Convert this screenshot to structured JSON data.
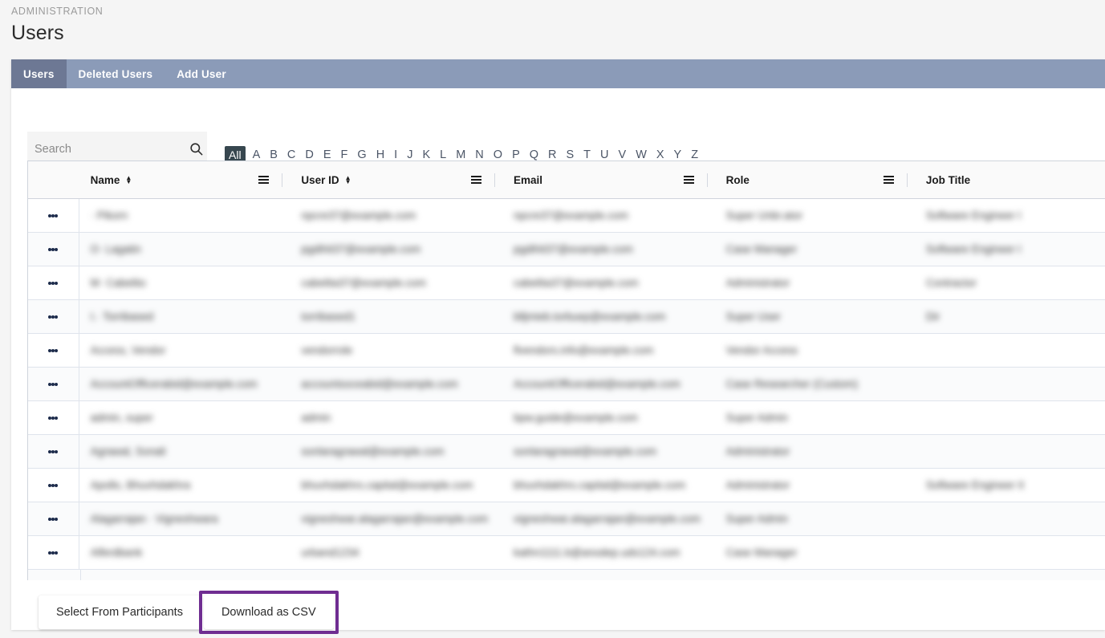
{
  "breadcrumb": "ADMINISTRATION",
  "page_title": "Users",
  "tabs": [
    {
      "label": "Users",
      "active": true
    },
    {
      "label": "Deleted Users",
      "active": false
    },
    {
      "label": "Add User",
      "active": false
    }
  ],
  "search": {
    "value": "",
    "placeholder": "Search",
    "icon": "search-icon"
  },
  "alpha_filter": {
    "selected": "All",
    "items": [
      "All",
      "A",
      "B",
      "C",
      "D",
      "E",
      "F",
      "G",
      "H",
      "I",
      "J",
      "K",
      "L",
      "M",
      "N",
      "O",
      "P",
      "Q",
      "R",
      "S",
      "T",
      "U",
      "V",
      "W",
      "X",
      "Y",
      "Z"
    ]
  },
  "table": {
    "columns": [
      {
        "key": "menu",
        "label": "",
        "sortable": false,
        "has_menu": false
      },
      {
        "key": "name",
        "label": "Name",
        "sortable": true,
        "has_menu": true
      },
      {
        "key": "uid",
        "label": "User ID",
        "sortable": true,
        "has_menu": true
      },
      {
        "key": "email",
        "label": "Email",
        "sortable": false,
        "has_menu": true
      },
      {
        "key": "role",
        "label": "Role",
        "sortable": false,
        "has_menu": true
      },
      {
        "key": "job",
        "label": "Job Title",
        "sortable": false,
        "has_menu": false
      }
    ],
    "sort_glyph_up": "▲",
    "sort_glyph_down": "▼",
    "redacted": true,
    "rows": [
      {
        "name": "· Pikorn",
        "uid": "npcre37@example.com",
        "email": "npcre37@example.com",
        "role": "Super Unbr.ator",
        "job": "Software Engineer I"
      },
      {
        "name": "O· Lagatin",
        "uid": "pgdihit37@example.com",
        "email": "pgdihit37@example.com",
        "role": "Case Manager",
        "job": "Software Engineer I"
      },
      {
        "name": "M· Cabelito",
        "uid": "cabelita37@example.com",
        "email": "cabelita37@example.com",
        "role": "Administrator",
        "job": "Contractor"
      },
      {
        "name": "I.· Torribased",
        "uid": "torribased1",
        "email": "blljmieb.torbuep@example.com",
        "role": "Super User",
        "job": "Dir"
      },
      {
        "name": "Access, Vendor",
        "uid": "vendorrole",
        "email": "flvendors.info@example.com",
        "role": "Vendor Access",
        "job": ""
      },
      {
        "name": "AccountOfficerabid@example.com",
        "uid": "accountsoceabid@example.com",
        "email": "AccountOfficerabid@example.com",
        "role": "Case Researcher (Custom)",
        "job": ""
      },
      {
        "name": "admin, super",
        "uid": "admin",
        "email": "bpw.guide@example.com",
        "role": "Super Admin",
        "job": ""
      },
      {
        "name": "Agrawal, Sonali",
        "uid": "sonlaragrawal@example.com",
        "email": "sonlaragrawal@example.com",
        "role": "Administrator",
        "job": ""
      },
      {
        "name": "Apollo, Bhuvhdakhra",
        "uid": "bhuvhdakhrs.capital@example.com",
        "email": "bhuvhdakhrs.capital@example.com",
        "role": "Administrator",
        "job": "Software Engineer II"
      },
      {
        "name": "Alagarrajan · Vigneshwara",
        "uid": "vigneshwar.alagarrajan@example.com",
        "email": "vigneshwar.alagarrajan@example.com",
        "role": "Super Admin",
        "job": ""
      },
      {
        "name": "Alferdbank",
        "uid": "urband1234",
        "email": "kathn1111.b@anodep.uds124.com",
        "role": "Case Manager",
        "job": ""
      }
    ]
  },
  "footer": {
    "select_participants_label": "Select From Participants",
    "download_csv_label": "Download as CSV",
    "highlight_color": "#6f2d91"
  }
}
